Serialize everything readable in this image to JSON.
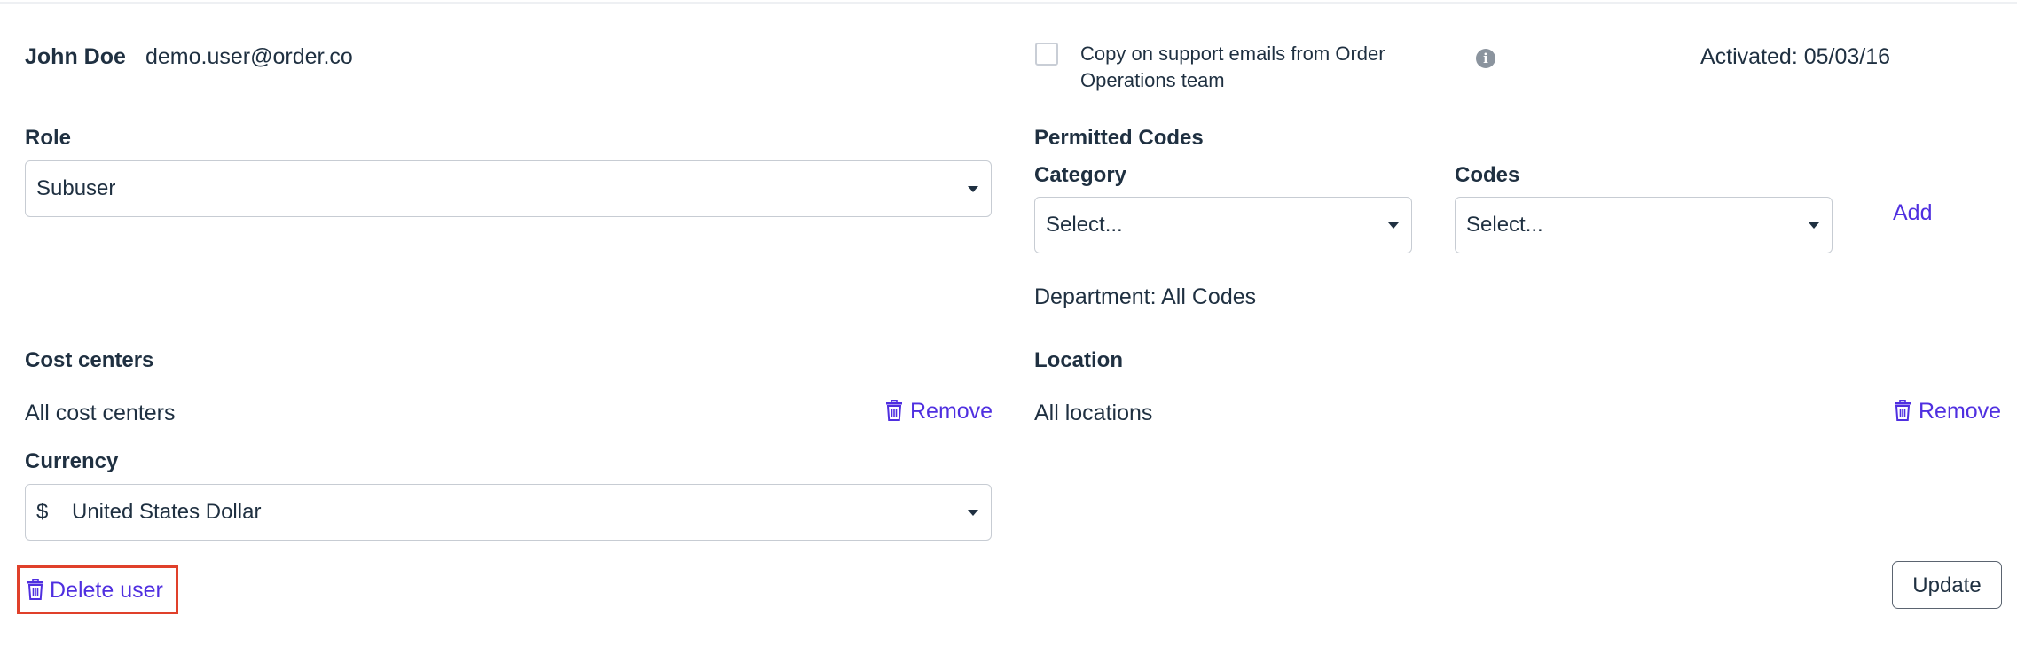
{
  "user": {
    "name": "John Doe",
    "email": "demo.user@order.co",
    "copy_emails_label": "Copy on support emails from Order Operations team",
    "activated": "Activated: 05/03/16"
  },
  "role": {
    "label": "Role",
    "value": "Subuser"
  },
  "permitted_codes": {
    "label": "Permitted Codes",
    "category_label": "Category",
    "category_value": "Select...",
    "codes_label": "Codes",
    "codes_value": "Select...",
    "add_label": "Add",
    "department_text": "Department: All Codes"
  },
  "cost_centers": {
    "label": "Cost centers",
    "value": "All cost centers",
    "remove_label": "Remove"
  },
  "location": {
    "label": "Location",
    "value": "All locations",
    "remove_label": "Remove"
  },
  "currency": {
    "label": "Currency",
    "symbol": "$",
    "value": "United States Dollar"
  },
  "actions": {
    "delete_label": "Delete user",
    "update_label": "Update"
  },
  "colors": {
    "link": "#4f2fe0",
    "text": "#1f3041",
    "highlight_border": "#e0402a"
  },
  "icons": {
    "trash": "trash-icon",
    "info": "info-icon",
    "caret": "chevron-down-icon"
  }
}
